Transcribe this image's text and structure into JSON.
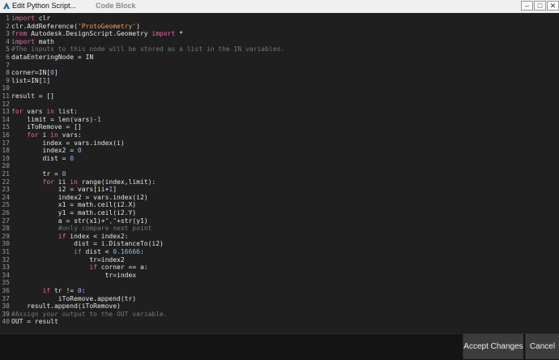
{
  "window": {
    "title": "Edit Python Script...",
    "ghost_title": "Code Block",
    "minimize_glyph": "–",
    "maximize_glyph": "□",
    "close_glyph": "✕",
    "icon": "autodesk-logo-icon"
  },
  "editor": {
    "lines": [
      [
        {
          "t": "kw",
          "v": "import"
        },
        {
          "t": "n",
          "v": " clr"
        }
      ],
      [
        {
          "t": "n",
          "v": "clr.AddReference("
        },
        {
          "t": "str",
          "v": "'ProtoGeometry'"
        },
        {
          "t": "n",
          "v": ")"
        }
      ],
      [
        {
          "t": "kw",
          "v": "from"
        },
        {
          "t": "n",
          "v": " Autodesk.DesignScript.Geometry "
        },
        {
          "t": "kw",
          "v": "import"
        },
        {
          "t": "n",
          "v": " *"
        }
      ],
      [
        {
          "t": "kw",
          "v": "import"
        },
        {
          "t": "n",
          "v": " math"
        }
      ],
      [
        {
          "t": "cm",
          "v": "#The inputs to this node will be stored as a list in the IN variables."
        }
      ],
      [
        {
          "t": "n",
          "v": "dataEnteringNode = IN"
        }
      ],
      [],
      [
        {
          "t": "n",
          "v": "corner=IN["
        },
        {
          "t": "num",
          "v": "0"
        },
        {
          "t": "n",
          "v": "]"
        }
      ],
      [
        {
          "t": "n",
          "v": "list=IN["
        },
        {
          "t": "num",
          "v": "1"
        },
        {
          "t": "n",
          "v": "]"
        }
      ],
      [],
      [
        {
          "t": "n",
          "v": "result = []"
        }
      ],
      [],
      [
        {
          "t": "kw",
          "v": "for"
        },
        {
          "t": "n",
          "v": " vars "
        },
        {
          "t": "kw",
          "v": "in"
        },
        {
          "t": "n",
          "v": " list:"
        }
      ],
      [
        {
          "t": "n",
          "v": "    limit = len(vars)-"
        },
        {
          "t": "num",
          "v": "1"
        }
      ],
      [
        {
          "t": "n",
          "v": "    iToRemove = []"
        }
      ],
      [
        {
          "t": "n",
          "v": "    "
        },
        {
          "t": "kw",
          "v": "for"
        },
        {
          "t": "n",
          "v": " i "
        },
        {
          "t": "kw",
          "v": "in"
        },
        {
          "t": "n",
          "v": " vars:"
        }
      ],
      [
        {
          "t": "n",
          "v": "        index = vars.index(i)"
        }
      ],
      [
        {
          "t": "n",
          "v": "        index2 = "
        },
        {
          "t": "num",
          "v": "0"
        }
      ],
      [
        {
          "t": "n",
          "v": "        dist = "
        },
        {
          "t": "num",
          "v": "0"
        }
      ],
      [],
      [
        {
          "t": "n",
          "v": "        tr = "
        },
        {
          "t": "num",
          "v": "0"
        }
      ],
      [
        {
          "t": "n",
          "v": "        "
        },
        {
          "t": "kw",
          "v": "for"
        },
        {
          "t": "n",
          "v": " ii "
        },
        {
          "t": "kw",
          "v": "in"
        },
        {
          "t": "n",
          "v": " range(index,limit):"
        }
      ],
      [
        {
          "t": "n",
          "v": "            i2 = vars[ii+"
        },
        {
          "t": "num",
          "v": "1"
        },
        {
          "t": "n",
          "v": "]"
        }
      ],
      [
        {
          "t": "n",
          "v": "            index2 = vars.index(i2)"
        }
      ],
      [
        {
          "t": "n",
          "v": "            x1 = math.ceil(i2.X)"
        }
      ],
      [
        {
          "t": "n",
          "v": "            y1 = math.ceil(i2.Y)"
        }
      ],
      [
        {
          "t": "n",
          "v": "            a = str(x1)+"
        },
        {
          "t": "str",
          "v": "\",\""
        },
        {
          "t": "n",
          "v": "+str(y1)"
        }
      ],
      [
        {
          "t": "n",
          "v": "            "
        },
        {
          "t": "cm",
          "v": "#only compare next point"
        }
      ],
      [
        {
          "t": "n",
          "v": "            "
        },
        {
          "t": "kw",
          "v": "if"
        },
        {
          "t": "n",
          "v": " index < index2:"
        }
      ],
      [
        {
          "t": "n",
          "v": "                dist = i.DistanceTo(i2)"
        }
      ],
      [
        {
          "t": "n",
          "v": "                "
        },
        {
          "t": "kw",
          "v": "if"
        },
        {
          "t": "n",
          "v": " dist < "
        },
        {
          "t": "num",
          "v": "0.16666"
        },
        {
          "t": "n",
          "v": ":"
        }
      ],
      [
        {
          "t": "n",
          "v": "                    tr=index2"
        }
      ],
      [
        {
          "t": "n",
          "v": "                    "
        },
        {
          "t": "kw",
          "v": "if"
        },
        {
          "t": "n",
          "v": " corner == a:"
        }
      ],
      [
        {
          "t": "n",
          "v": "                        tr=index"
        }
      ],
      [],
      [
        {
          "t": "n",
          "v": "        "
        },
        {
          "t": "kw",
          "v": "if"
        },
        {
          "t": "n",
          "v": " tr != "
        },
        {
          "t": "num",
          "v": "0"
        },
        {
          "t": "n",
          "v": ":"
        }
      ],
      [
        {
          "t": "n",
          "v": "            iToRemove.append(tr)"
        }
      ],
      [
        {
          "t": "n",
          "v": "    result.append(iToRemove)"
        }
      ],
      [
        {
          "t": "cm",
          "v": "#Assign your output to the OUT variable."
        }
      ],
      [
        {
          "t": "n",
          "v": "OUT = result"
        }
      ]
    ]
  },
  "buttons": {
    "accept_label": "Accept Changes",
    "cancel_label": "Cancel"
  },
  "colors": {
    "keyword": "#e868a8",
    "string": "#e8a060",
    "number": "#8db8ff",
    "comment": "#6a7f6a",
    "editor_bg": "#1f1f1f"
  }
}
